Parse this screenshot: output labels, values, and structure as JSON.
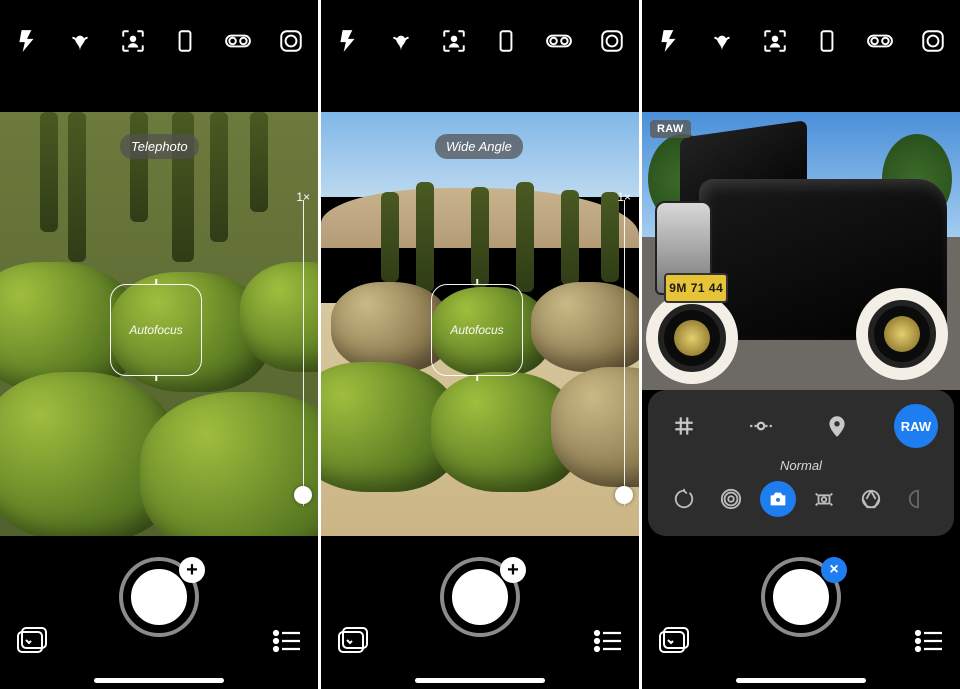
{
  "colors": {
    "accent": "#1e7ef0"
  },
  "topbar_icons": [
    "flash-icon",
    "macro-icon",
    "portrait-icon",
    "aspect-icon",
    "dual-lens-icon",
    "filter-icon"
  ],
  "screens": [
    {
      "lens_label": "Telephoto",
      "zoom_label": "1×",
      "focus_label": "Autofocus",
      "shutter_badge": "+",
      "has_panel": false,
      "style": "tele"
    },
    {
      "lens_label": "Wide Angle",
      "zoom_label": "1×",
      "focus_label": "Autofocus",
      "shutter_badge": "+",
      "has_panel": false,
      "style": "wide"
    },
    {
      "raw_badge": "RAW",
      "shutter_badge": "×",
      "has_panel": true,
      "license_plate": "9M 71 44",
      "panel": {
        "top_icons": [
          "grid-icon",
          "level-icon",
          "location-icon"
        ],
        "raw_label": "RAW",
        "mode_label": "Normal",
        "modes": [
          "timer-mode-icon",
          "burst-mode-icon",
          "normal-mode-icon",
          "stabilize-mode-icon",
          "aperture-mode-icon",
          "half-mode-icon"
        ],
        "active_mode_index": 2
      }
    }
  ]
}
